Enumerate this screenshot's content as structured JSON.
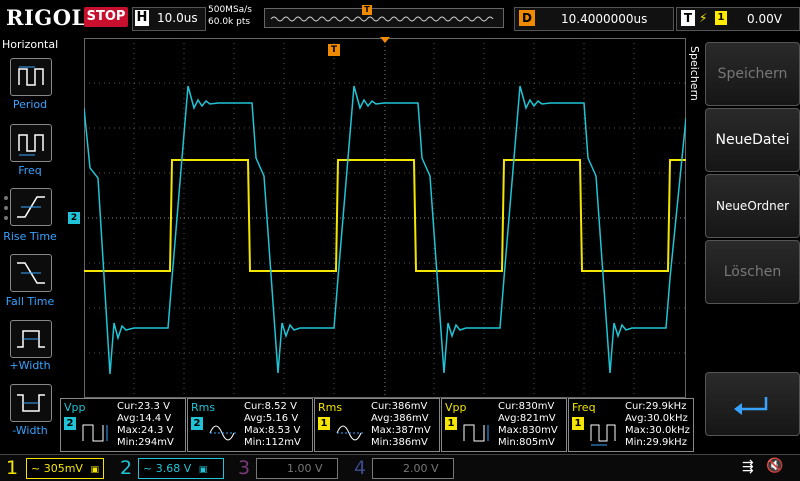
{
  "topbar": {
    "brand": "RIGOL",
    "run_state": "STOP",
    "horizontal_label": "H",
    "timebase": "10.0us",
    "sample_rate": "500MSa/s",
    "memory_depth": "60.0k pts",
    "trigger_marker": "T",
    "delay_label": "D",
    "delay_value": "10.4000000us",
    "trigger_label": "T",
    "trigger_source": "1",
    "trigger_level": "0.00V"
  },
  "left_menu": {
    "title": "Horizontal",
    "items": [
      {
        "label": "Period",
        "icon": "period-icon"
      },
      {
        "label": "Freq",
        "icon": "frequency-icon"
      },
      {
        "label": "Rise Time",
        "icon": "rise-time-icon"
      },
      {
        "label": "Fall Time",
        "icon": "fall-time-icon"
      },
      {
        "label": "+Width",
        "icon": "positive-width-icon"
      },
      {
        "label": "-Width",
        "icon": "negative-width-icon"
      }
    ]
  },
  "right_menu": {
    "title": "Speichern",
    "buttons": [
      {
        "label": "Speichern",
        "enabled": false
      },
      {
        "label": "NeueDatei",
        "enabled": true
      },
      {
        "label": "NeueOrdner",
        "enabled": true
      },
      {
        "label": "Löschen",
        "enabled": false
      },
      {
        "label": "",
        "icon": "return-arrow-icon",
        "enabled": true
      }
    ]
  },
  "waveform": {
    "ch2_marker": "2",
    "trigger_level_marker": "T",
    "colors": {
      "ch1": "#f4e600",
      "ch2": "#21c4d6",
      "grid": "#5a5a5a",
      "trigger": "#f08a00"
    }
  },
  "measurements": [
    {
      "name": "Vpp",
      "source": "2",
      "cur": "Cur:23.3 V",
      "avg": "Avg:14.4 V",
      "max": "Max:24.3 V",
      "min": "Min:294mV",
      "name_color": "#21c4d6",
      "icon": "vpp-icon"
    },
    {
      "name": "Rms",
      "source": "2",
      "cur": "Cur:8.52 V",
      "avg": "Avg:5.16 V",
      "max": "Max:8.53 V",
      "min": "Min:112mV",
      "name_color": "#21c4d6",
      "icon": "rms-icon"
    },
    {
      "name": "Rms",
      "source": "1",
      "cur": "Cur:386mV",
      "avg": "Avg:386mV",
      "max": "Max:387mV",
      "min": "Min:386mV",
      "name_color": "#f4e600",
      "icon": "rms-icon"
    },
    {
      "name": "Vpp",
      "source": "1",
      "cur": "Cur:830mV",
      "avg": "Avg:821mV",
      "max": "Max:830mV",
      "min": "Min:805mV",
      "name_color": "#f4e600",
      "icon": "vpp-icon"
    },
    {
      "name": "Freq",
      "source": "1",
      "cur": "Cur:29.9kHz",
      "avg": "Avg:30.0kHz",
      "max": "Max:30.0kHz",
      "min": "Min:29.9kHz",
      "name_color": "#f4e600",
      "icon": "frequency-icon"
    }
  ],
  "channels": [
    {
      "num": "1",
      "scale": "305mV",
      "coupling": "~",
      "color": "#f4e600",
      "active": true
    },
    {
      "num": "2",
      "scale": "3.68 V",
      "coupling": "~",
      "color": "#21c4d6",
      "active": true
    },
    {
      "num": "3",
      "scale": "1.00 V",
      "coupling": "",
      "color": "#7a3a7a",
      "active": false
    },
    {
      "num": "4",
      "scale": "2.00 V",
      "coupling": "",
      "color": "#3a4a8a",
      "active": false
    }
  ]
}
